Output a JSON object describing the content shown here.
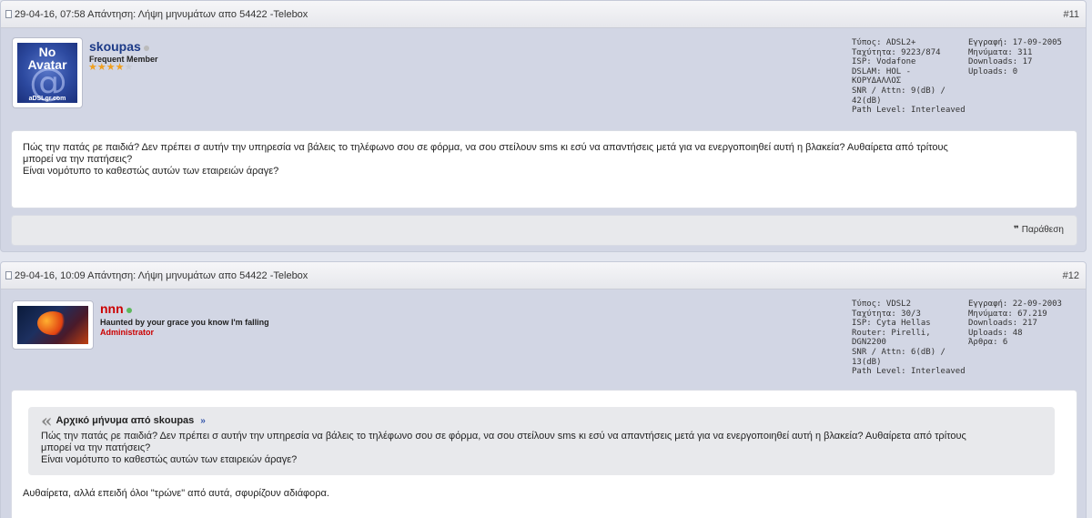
{
  "posts": [
    {
      "header": "29-04-16, 07:58 Απάντηση: Λήψη μηνυμάτων απο 54422 -Telebox",
      "number": "#11",
      "user": {
        "name": "skoupas",
        "name_color": "#1c3a87",
        "online_color": "#bbbbbb",
        "title": "Frequent Member",
        "avatar": {
          "line1": "No",
          "line2": "Avatar",
          "symbol": "@",
          "caption": "aDSLgr.com"
        }
      },
      "stats_left": [
        "Τύπος: ADSL2+",
        "Ταχύτητα: 9223/874",
        "ISP: Vodafone",
        "DSLAM: HOL -",
        "ΚΟΡΥΔΑΛΛΟΣ",
        "SNR / Attn: 9(dB) /",
        "42(dB)",
        "Path Level: Interleaved"
      ],
      "stats_right": [
        "Εγγραφή: 17-09-2005",
        "Μηνύματα: 311",
        "Downloads: 17",
        "Uploads: 0"
      ],
      "message": [
        "Πώς την πατάς ρε παιδιά? Δεν πρέπει σ αυτήν την υπηρεσία να βάλεις το τηλέφωνο σου σε φόρμα, να σου στείλουν sms κι εσύ να απαντήσεις μετά για να ενεργοποιηθεί αυτή η βλακεία? Αυθαίρετα από τρίτους",
        "μπορεί να την πατήσεις?",
        "Είναι νομότυπο το καθεστώς αυτών των εταιρειών άραγε?"
      ],
      "quote_button": "Παράθεση"
    },
    {
      "header": "29-04-16, 10:09 Απάντηση: Λήψη μηνυμάτων απο 54422 -Telebox",
      "number": "#12",
      "user": {
        "name": "nnn",
        "name_color": "#cc0000",
        "online_color": "#5cb85c",
        "title": "Haunted by your grace you know I'm falling",
        "role": "Administrator"
      },
      "stats_left": [
        "Τύπος: VDSL2",
        "Ταχύτητα: 30/3",
        "ISP: Cyta Hellas",
        "Router: Pirelli,",
        "DGN2200",
        "SNR / Attn: 6(dB) /",
        "13(dB)",
        "Path Level: Interleaved"
      ],
      "stats_right": [
        "Εγγραφή: 22-09-2003",
        "Μηνύματα: 67.219",
        "Downloads: 217",
        "Uploads: 48",
        "Άρθρα: 6"
      ],
      "quote": {
        "title": "Αρχικό μήνυμα από skoupas",
        "lines": [
          "Πώς την πατάς ρε παιδιά? Δεν πρέπει σ αυτήν την υπηρεσία να βάλεις το τηλέφωνο σου σε φόρμα, να σου στείλουν sms κι εσύ να απαντήσεις μετά για να ενεργοποιηθεί αυτή η βλακεία? Αυθαίρετα από τρίτους",
          "μπορεί να την πατήσεις?",
          "Είναι νομότυπο το καθεστώς αυτών των εταιρειών άραγε?"
        ]
      },
      "message": [
        "Αυθαίρετα, αλλά επειδή όλοι \"τρώνε\" από αυτά, σφυρίζουν αδιάφορα."
      ]
    }
  ]
}
